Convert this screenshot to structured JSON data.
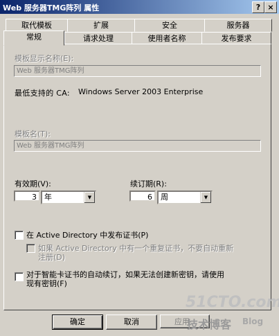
{
  "window": {
    "title": "Web 服务器TMG阵列 属性",
    "help_button": "?",
    "close_button": "×"
  },
  "tabs_row1": [
    "取代模板",
    "扩展",
    "安全",
    "服务器"
  ],
  "tabs_row2": [
    "常规",
    "请求处理",
    "使用者名称",
    "发布要求"
  ],
  "general": {
    "display_name_label": "模板显示名称(E):",
    "display_name_value": "Web 服务器TMG阵列",
    "min_ca_label": "最低支持的 CA:",
    "min_ca_value": "Windows Server 2003 Enterprise",
    "template_name_label": "模板名(T):",
    "template_name_value": "Web 服务器TMG阵列",
    "validity_label": "有效期(V):",
    "validity_value": "3",
    "validity_unit": "年",
    "renewal_label": "续订期(R):",
    "renewal_value": "6",
    "renewal_unit": "周",
    "publish_ad_label": "在 Active Directory 中发布证书(P)",
    "no_auto_reenroll_label_1": "如果 Active Directory 中有一个重复证书，不要自动重新",
    "no_auto_reenroll_label_2": "注册(D)",
    "smartcard_label_1": "对于智能卡证书的自动续订，如果无法创建新密钥，请使用",
    "smartcard_label_2": "现有密钥(F)"
  },
  "buttons": {
    "ok": "确定",
    "cancel": "取消",
    "apply": "应用"
  },
  "watermark": {
    "site": "51CTO.com",
    "caption": "技术博客",
    "blog": "Blog"
  }
}
